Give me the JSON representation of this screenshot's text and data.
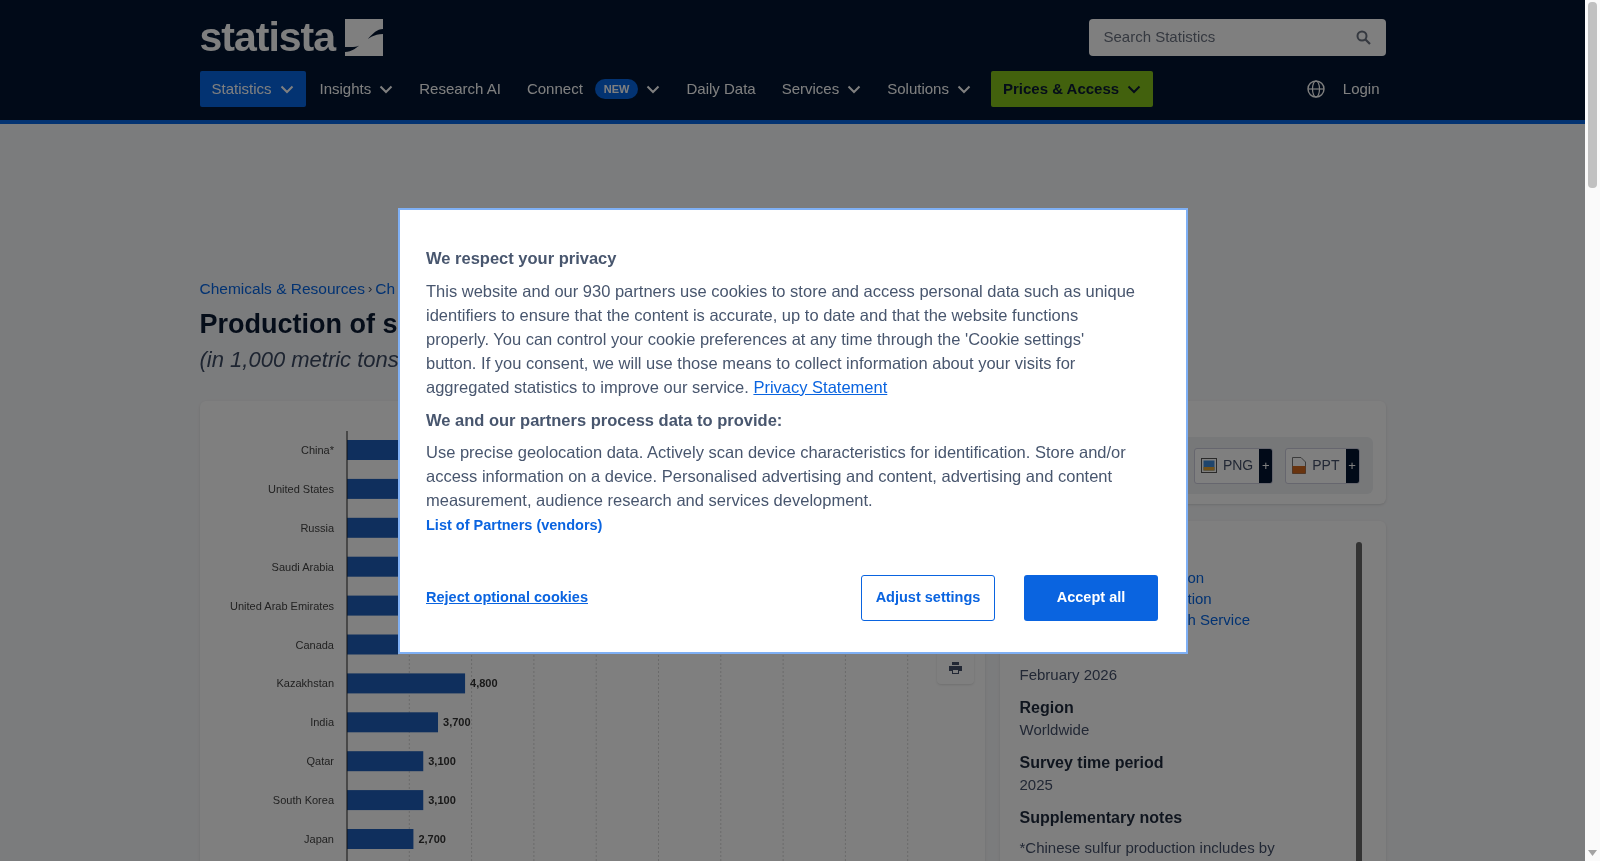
{
  "header": {
    "logo": "statista",
    "search": {
      "placeholder": "Search Statistics"
    },
    "nav": [
      {
        "label": "Statistics",
        "kind": "tab",
        "menu": true,
        "selected": true
      },
      {
        "label": "Insights",
        "kind": "tab",
        "menu": true,
        "selected": false
      },
      {
        "label": "Research AI",
        "kind": "tab",
        "menu": false,
        "selected": false
      },
      {
        "label": "Connect",
        "kind": "tab",
        "menu": true,
        "badge": "NEW",
        "selected": false
      },
      {
        "label": "Daily Data",
        "kind": "tab",
        "menu": false,
        "selected": false
      },
      {
        "label": "Services",
        "kind": "tab",
        "menu": true,
        "selected": false
      },
      {
        "label": "Solutions",
        "kind": "tab",
        "menu": true,
        "selected": false
      },
      {
        "label": "Prices & Access",
        "kind": "cta",
        "menu": true,
        "selected": false
      }
    ],
    "login": "Login"
  },
  "breadcrumb": {
    "items": [
      "Chemicals & Resources",
      "Ch"
    ],
    "separator": "›"
  },
  "title": "Production of s",
  "subtitle": "(in 1,000 metric tons",
  "chart": {
    "chart_data": {
      "type": "bar",
      "orientation": "horizontal",
      "categories": [
        "China*",
        "United States",
        "Russia",
        "Saudi Arabia",
        "United Arab Emirates",
        "Canada",
        "Kazakhstan",
        "India",
        "Qatar",
        "South Korea",
        "Japan"
      ],
      "values": [
        null,
        null,
        null,
        null,
        null,
        null,
        4800,
        3700,
        3100,
        3100,
        2700
      ],
      "value_labels": [
        null,
        null,
        null,
        null,
        null,
        null,
        "4,800",
        "3,700",
        "3,100",
        "3,100",
        "2,700"
      ]
    }
  },
  "downloads": [
    {
      "label": "PNG",
      "kind": "png",
      "more": "+"
    },
    {
      "label": "PPT",
      "kind": "ppt",
      "more": "+"
    }
  ],
  "details": {
    "links": [
      "on",
      "tion",
      "h Service"
    ],
    "fields": [
      {
        "value": "February 2026"
      },
      {
        "label": "Region",
        "value": "Worldwide"
      },
      {
        "label": "Survey time period",
        "value": "2025"
      },
      {
        "label": "Supplementary notes",
        "value": "*Chinese sulfur production includes by"
      }
    ]
  },
  "cookie_dialog": {
    "title": "We respect your privacy",
    "body": "This website and our 930 partners use cookies to store and access personal data such as unique identifiers to ensure that the content is accurate, up to date and that the website functions properly. You can control your cookie preferences at any time through the 'Cookie settings' button. If you consent, we will use those means to collect information about your visits for aggregated statistics to improve our service.",
    "privacy_link": "Privacy Statement",
    "purposes_title": "We and our partners process data to provide:",
    "purposes": "Use precise geolocation data. Actively scan device characteristics for identification. Store and/or access information on a device. Personalised advertising and content, advertising and content measurement, audience research and services development.",
    "partners_link": "List of Partners (vendors)",
    "reject": "Reject optional cookies",
    "adjust": "Adjust settings",
    "accept": "Accept all"
  }
}
